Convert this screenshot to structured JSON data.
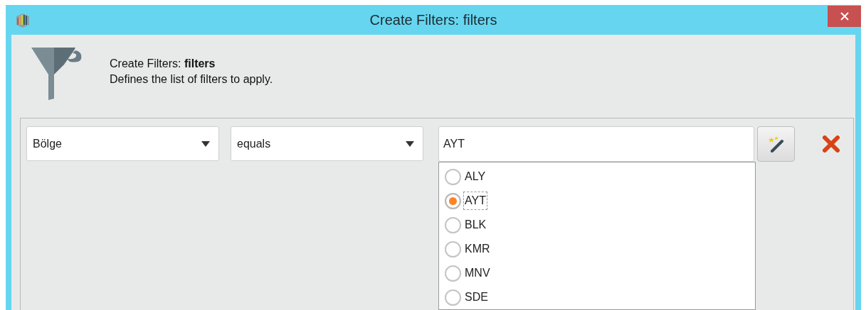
{
  "window": {
    "title": "Create Filters: filters"
  },
  "header": {
    "title": "Create Filters: **filters**",
    "description": "Defines the list of filters to apply."
  },
  "filter": {
    "field": "Bölge",
    "operator": "equals",
    "value": "AYT",
    "options": [
      {
        "label": "ALY",
        "selected": false
      },
      {
        "label": "AYT",
        "selected": true
      },
      {
        "label": "BLK",
        "selected": false
      },
      {
        "label": "KMR",
        "selected": false
      },
      {
        "label": "MNV",
        "selected": false
      },
      {
        "label": "SDE",
        "selected": false
      }
    ]
  }
}
